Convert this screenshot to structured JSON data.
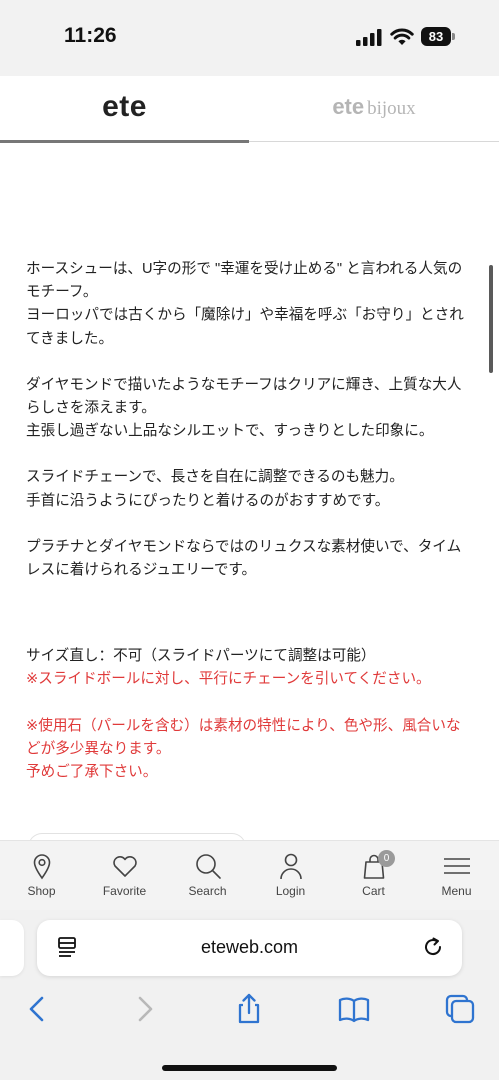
{
  "status_bar": {
    "time": "11:26",
    "battery": "83"
  },
  "brand_tabs": {
    "ete": "ete",
    "bijoux_main": "ete",
    "bijoux_sub": "bijoux"
  },
  "content": {
    "p1a": "ホースシューは、U字の形で \"幸運を受け止める\" と言われる人気のモチーフ。",
    "p1b": "ヨーロッパでは古くから「魔除け」や幸福を呼ぶ「お守り」とされてきました。",
    "p2a": "ダイヤモンドで描いたようなモチーフはクリアに輝き、上質な大人らしさを添えます。",
    "p2b": "主張し過ぎない上品なシルエットで、すっきりとした印象に。",
    "p3a": "スライドチェーンで、長さを自在に調整できるのも魅力。",
    "p3b": "手首に沿うようにぴったりと着けるのがおすすめです。",
    "p4": "プラチナとダイヤモンドならではのリュクスな素材使いで、タイムレスに着けられるジュエリーです。",
    "size_note": "サイズ直し：不可（スライドパーツにて調整は可能）",
    "size_warning": "※スライドボールに対し、平行にチェーンを引いてください。",
    "stone_note1": "※使用石（パールを含む）は素材の特性により、色や形、風合いなどが多少異なります。",
    "stone_note2": "予めご了承下さい。"
  },
  "site_nav": {
    "shop": "Shop",
    "favorite": "Favorite",
    "search": "Search",
    "login": "Login",
    "cart": "Cart",
    "cart_count": "0",
    "menu": "Menu"
  },
  "browser": {
    "url": "eteweb.com"
  },
  "colors": {
    "warning_red": "#e03a3a",
    "nav_bg": "#f3f3f3",
    "chrome_bg": "#f1f1f1",
    "safari_blue": "#2f74d0"
  }
}
